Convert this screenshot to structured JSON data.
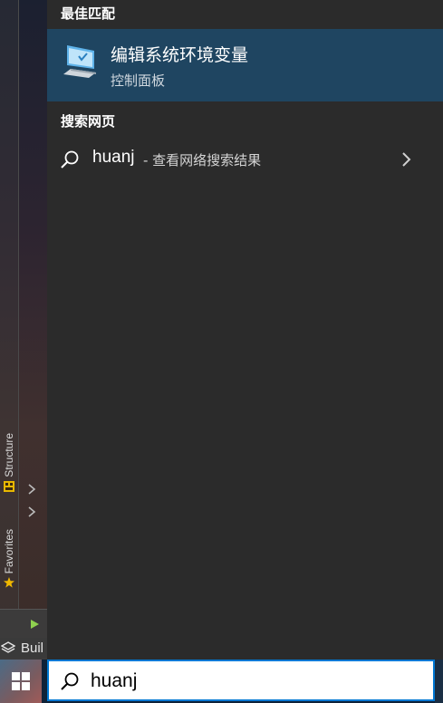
{
  "best_match": {
    "heading": "最佳匹配",
    "title": "编辑系统环境变量",
    "subtitle": "控制面板",
    "icon": "computer-settings-icon"
  },
  "web_search": {
    "heading": "搜索网页",
    "query": "huanj",
    "suffix": "- 查看网络搜索结果",
    "icon": "search-icon"
  },
  "search_box": {
    "value": "huanj",
    "icon": "search-icon"
  },
  "ide_sidebar": {
    "structure_tab": "Structure",
    "favorites_tab": "Favorites",
    "build_label": "Buil"
  },
  "colors": {
    "panel_bg": "#2b2b2b",
    "selected_bg": "#1f4561",
    "accent": "#0078d4",
    "taskbar_bg": "#0f2238"
  }
}
